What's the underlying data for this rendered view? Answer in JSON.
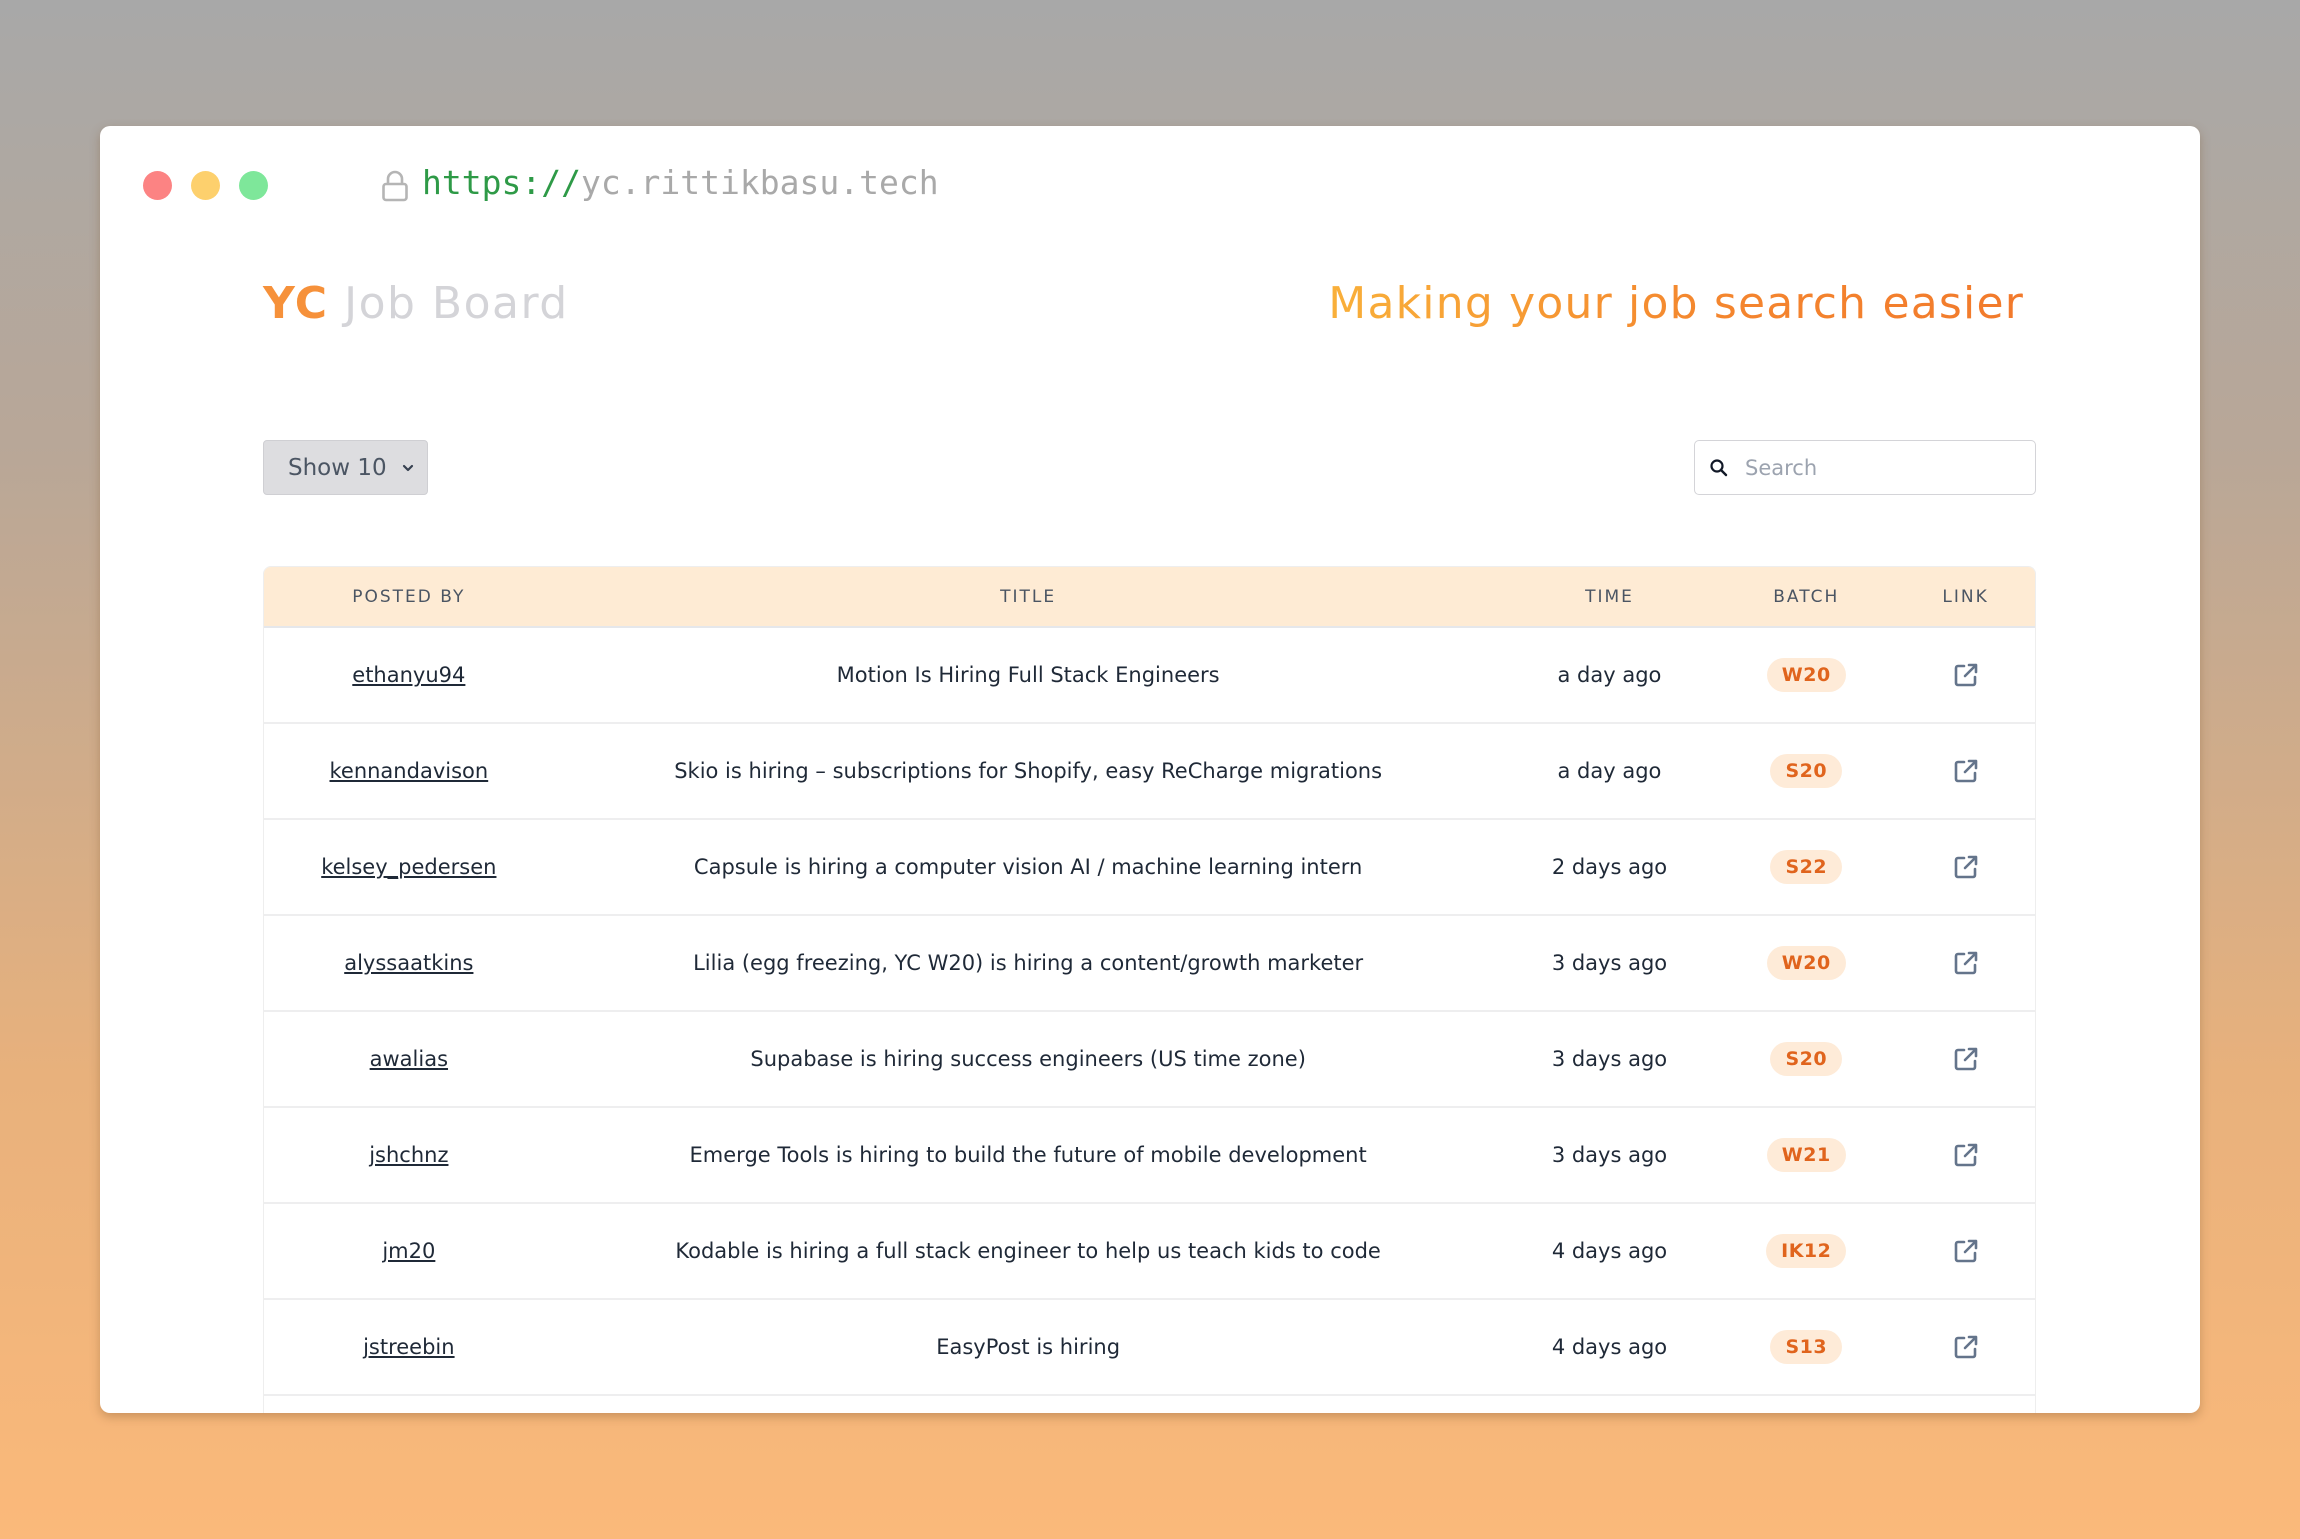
{
  "browser": {
    "url_scheme": "https://",
    "url_host": "yc.rittikbasu.tech",
    "icons": {
      "lock": "lock-icon"
    },
    "traffic_lights": {
      "close": "#fc8383",
      "minimize": "#fdd06d",
      "maximize": "#7ee79a"
    }
  },
  "header": {
    "brand_accent": "YC",
    "brand_rest": "Job Board",
    "tagline": "Making your job search easier"
  },
  "controls": {
    "page_size_label": "Show 10",
    "search_placeholder": "Search",
    "search_value": ""
  },
  "table": {
    "columns": [
      "Posted By",
      "Title",
      "Time",
      "Batch",
      "Link"
    ],
    "rows": [
      {
        "posted_by": "ethanyu94",
        "title": "Motion Is Hiring Full Stack Engineers",
        "time": "a day ago",
        "batch": "W20"
      },
      {
        "posted_by": "kennandavison",
        "title": "Skio is hiring – subscriptions for Shopify, easy ReCharge migrations",
        "time": "a day ago",
        "batch": "S20"
      },
      {
        "posted_by": "kelsey_pedersen",
        "title": "Capsule is hiring a computer vision AI / machine learning intern",
        "time": "2 days ago",
        "batch": "S22"
      },
      {
        "posted_by": "alyssaatkins",
        "title": "Lilia (egg freezing, YC W20) is hiring a content/growth marketer",
        "time": "3 days ago",
        "batch": "W20"
      },
      {
        "posted_by": "awalias",
        "title": "Supabase is hiring success engineers (US time zone)",
        "time": "3 days ago",
        "batch": "S20"
      },
      {
        "posted_by": "jshchnz",
        "title": "Emerge Tools is hiring to build the future of mobile development",
        "time": "3 days ago",
        "batch": "W21"
      },
      {
        "posted_by": "jm20",
        "title": "Kodable is hiring a full stack engineer to help us teach kids to code",
        "time": "4 days ago",
        "batch": "IK12"
      },
      {
        "posted_by": "jstreebin",
        "title": "EasyPost is hiring",
        "time": "4 days ago",
        "batch": "S13"
      }
    ]
  },
  "colors": {
    "accent": "#f6913a",
    "header_bg": "#feebd4",
    "badge_bg": "#feebd8",
    "badge_text": "#e0641d",
    "url_scheme": "#2e9a47"
  }
}
